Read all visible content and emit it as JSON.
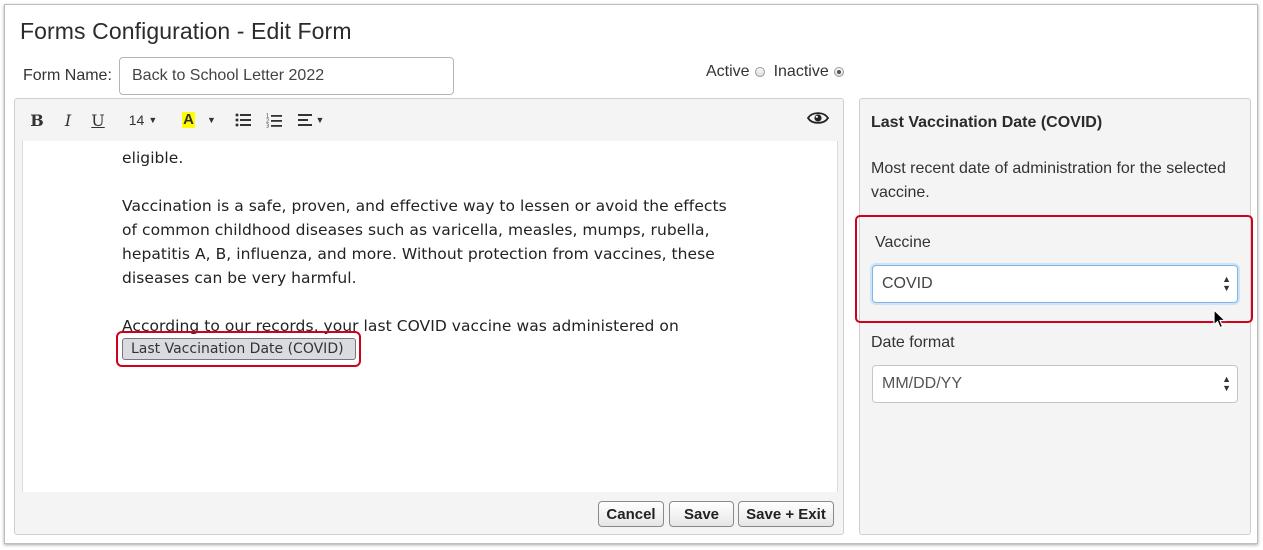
{
  "page": {
    "title": "Forms Configuration - Edit Form",
    "form_name_label": "Form Name:",
    "form_name_value": "Back to School Letter 2022",
    "status": {
      "active_label": "Active",
      "inactive_label": "Inactive",
      "selected": "Inactive"
    }
  },
  "toolbar": {
    "bold": "B",
    "italic": "I",
    "underline": "U",
    "font_size": "14",
    "color_label": "A",
    "icons": [
      "bulleted-list-icon",
      "numbered-list-icon",
      "align-icon",
      "eye-icon"
    ]
  },
  "editor": {
    "paragraphs": [
      "eligible.",
      "Vaccination is a safe, proven, and effective way to lessen or avoid the effects of common childhood diseases such as varicella, measles, mumps, rubella, hepatitis A, B, influenza, and more. Without protection from vaccines, these diseases can be very harmful.",
      "According to our records, your last COVID vaccine was administered on"
    ],
    "merge_field": "Last Vaccination Date (COVID)"
  },
  "footer": {
    "cancel": "Cancel",
    "save": "Save",
    "save_exit": "Save + Exit"
  },
  "panel": {
    "title": "Last Vaccination Date (COVID)",
    "description": "Most recent date of administration for the selected vaccine.",
    "vaccine_label": "Vaccine",
    "vaccine_value": "COVID",
    "date_format_label": "Date format",
    "date_format_value": "MM/DD/YY"
  },
  "colors": {
    "highlight": "#d0021b",
    "focus": "#7fb5e8",
    "font_color_swatch": "#ffff00"
  }
}
